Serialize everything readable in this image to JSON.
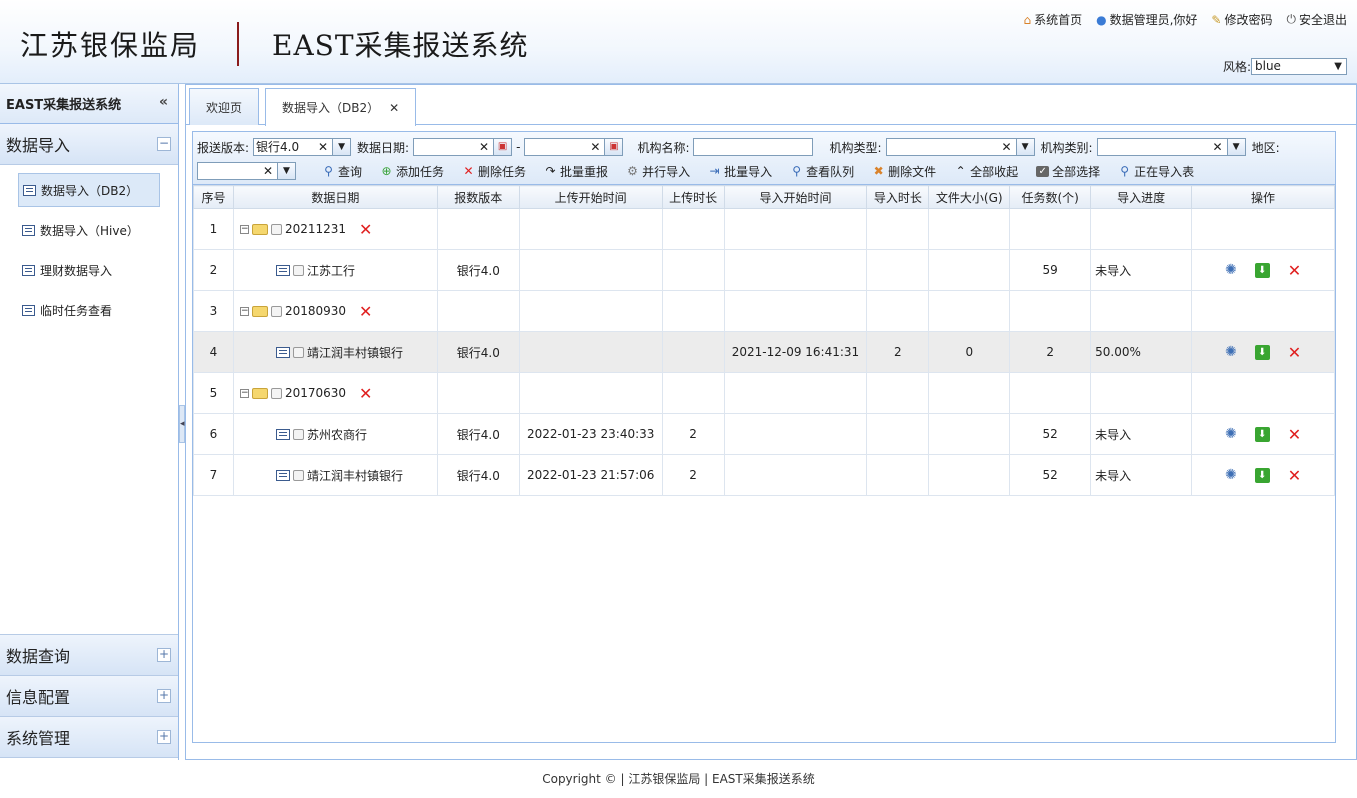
{
  "header": {
    "brand": "江苏银保监局",
    "system": "EAST采集报送系统",
    "links": [
      {
        "icon": "home-icon",
        "label": "系统首页"
      },
      {
        "icon": "user-icon",
        "label": "数据管理员,你好"
      },
      {
        "icon": "edit-icon",
        "label": "修改密码"
      },
      {
        "icon": "power-icon",
        "label": "安全退出"
      }
    ],
    "style_label": "风格:",
    "style_value": "blue"
  },
  "sidebar": {
    "title": "EAST采集报送系统",
    "groups": [
      {
        "label": "数据导入",
        "expanded": true
      },
      {
        "label": "数据查询",
        "expanded": false
      },
      {
        "label": "信息配置",
        "expanded": false
      },
      {
        "label": "系统管理",
        "expanded": false
      }
    ],
    "items": [
      "数据导入（DB2）",
      "数据导入（Hive）",
      "理财数据导入",
      "临时任务查看"
    ]
  },
  "tabs": [
    {
      "label": "欢迎页"
    },
    {
      "label": "数据导入（DB2）"
    }
  ],
  "filters": {
    "version_label": "报送版本:",
    "version_value": "银行4.0",
    "date_label": "数据日期:",
    "date_sep": "-",
    "org_name_label": "机构名称:",
    "org_type_label": "机构类型:",
    "org_category_label": "机构类别:",
    "region_label": "地区:"
  },
  "actions": [
    {
      "icon": "search-icon",
      "label": "查询"
    },
    {
      "icon": "add-icon",
      "label": "添加任务"
    },
    {
      "icon": "delete-icon",
      "label": "删除任务"
    },
    {
      "icon": "redo-icon",
      "label": "批量重报"
    },
    {
      "icon": "gear-icon",
      "label": "并行导入"
    },
    {
      "icon": "import-icon",
      "label": "批量导入"
    },
    {
      "icon": "magnifier-icon",
      "label": "查看队列"
    },
    {
      "icon": "remove-file-icon",
      "label": "删除文件"
    },
    {
      "icon": "collapse-icon",
      "label": "全部收起"
    },
    {
      "icon": "checkbox-icon",
      "label": "全部选择"
    },
    {
      "icon": "search-icon",
      "label": "正在导入表"
    }
  ],
  "table": {
    "columns": [
      "序号",
      "数据日期",
      "报数版本",
      "上传开始时间",
      "上传时长",
      "导入开始时间",
      "导入时长",
      "文件大小(G)",
      "任务数(个)",
      "导入进度",
      "操作"
    ],
    "rows": [
      {
        "no": "1",
        "type": "folder",
        "date": "20211231",
        "version": "",
        "upload_start": "",
        "upload_dur": "",
        "import_start": "",
        "import_dur": "",
        "size": "",
        "tasks": "",
        "progress": ""
      },
      {
        "no": "2",
        "type": "leaf",
        "date": "江苏工行",
        "version": "银行4.0",
        "upload_start": "",
        "upload_dur": "",
        "import_start": "",
        "import_dur": "",
        "size": "",
        "tasks": "59",
        "progress": "未导入"
      },
      {
        "no": "3",
        "type": "folder",
        "date": "20180930",
        "version": "",
        "upload_start": "",
        "upload_dur": "",
        "import_start": "",
        "import_dur": "",
        "size": "",
        "tasks": "",
        "progress": ""
      },
      {
        "no": "4",
        "type": "leaf",
        "date": "靖江润丰村镇银行",
        "version": "银行4.0",
        "upload_start": "",
        "upload_dur": "",
        "import_start": "2021-12-09 16:41:31",
        "import_dur": "2",
        "size": "0",
        "tasks": "2",
        "progress": "50.00%"
      },
      {
        "no": "5",
        "type": "folder",
        "date": "20170630",
        "version": "",
        "upload_start": "",
        "upload_dur": "",
        "import_start": "",
        "import_dur": "",
        "size": "",
        "tasks": "",
        "progress": ""
      },
      {
        "no": "6",
        "type": "leaf",
        "date": "苏州农商行",
        "version": "银行4.0",
        "upload_start": "2022-01-23 23:40:33",
        "upload_dur": "2",
        "import_start": "",
        "import_dur": "",
        "size": "",
        "tasks": "52",
        "progress": "未导入"
      },
      {
        "no": "7",
        "type": "leaf",
        "date": "靖江润丰村镇银行",
        "version": "银行4.0",
        "upload_start": "2022-01-23 21:57:06",
        "upload_dur": "2",
        "import_start": "",
        "import_dur": "",
        "size": "",
        "tasks": "52",
        "progress": "未导入"
      }
    ]
  },
  "footer": "Copyright © | 江苏银保监局 | EAST采集报送系统",
  "colors": {
    "accent": "#99bbe8",
    "delete": "#e02020",
    "download": "#39a531"
  }
}
